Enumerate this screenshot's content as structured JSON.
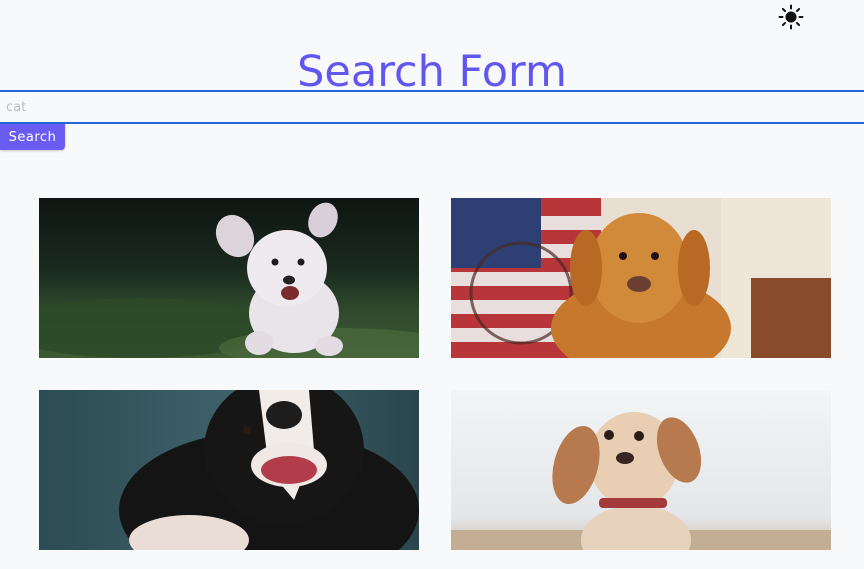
{
  "header": {
    "theme_icon": "sun-icon"
  },
  "main": {
    "title": "Search Form",
    "search": {
      "value": "",
      "placeholder": "cat"
    },
    "search_button_label": "Search"
  },
  "gallery": {
    "images": [
      {
        "subject": "white-fluffy-dog-running-on-grass"
      },
      {
        "subject": "golden-retriever-in-front-of-flag"
      },
      {
        "subject": "black-and-white-border-collie-smiling"
      },
      {
        "subject": "spaniel-puppy-with-red-collar"
      }
    ]
  },
  "colors": {
    "accent": "#6157ef",
    "button": "#6a5cf2",
    "input_border": "#2563d6",
    "background": "#f8f9fb"
  }
}
